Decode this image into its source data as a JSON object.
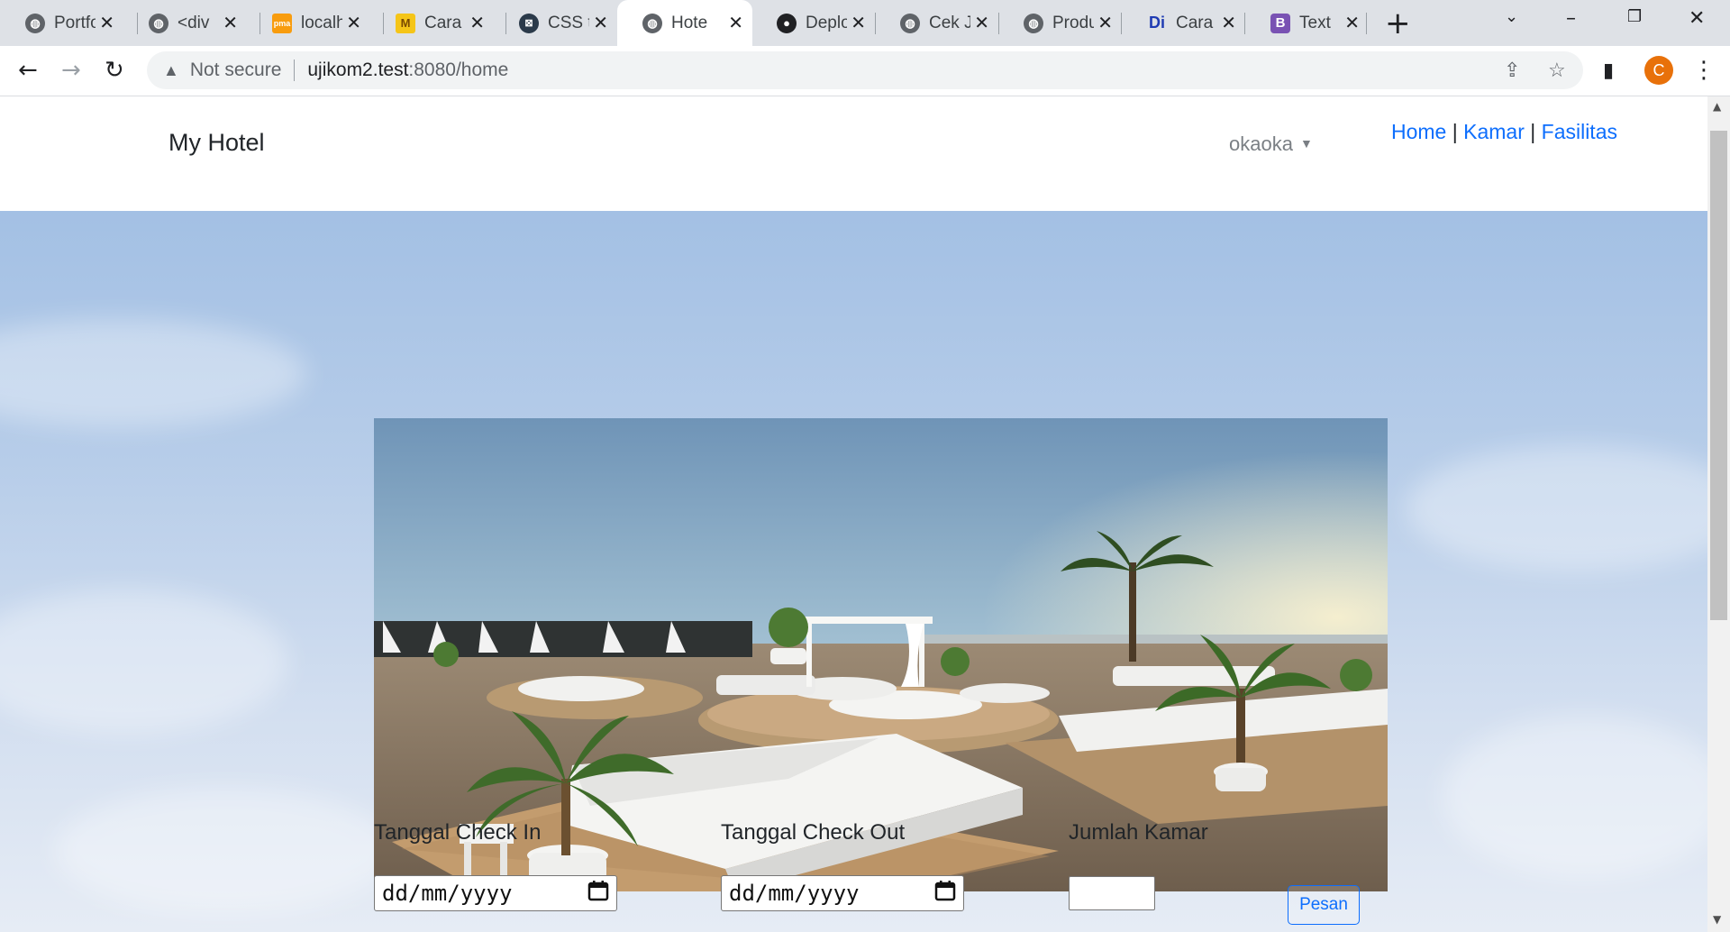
{
  "browser": {
    "tabs": [
      {
        "title": "Portfo",
        "favicon": "globe-icon"
      },
      {
        "title": "<div",
        "favicon": "globe-icon"
      },
      {
        "title": "localh",
        "favicon": "phpmyadmin-icon"
      },
      {
        "title": "Cara",
        "favicon": "mojok-icon"
      },
      {
        "title": "CSS t",
        "favicon": "w3-icon"
      },
      {
        "title": "Hote",
        "favicon": "globe-icon",
        "active": true
      },
      {
        "title": "Deplo",
        "favicon": "github-icon"
      },
      {
        "title": "Cek J",
        "favicon": "globe-icon"
      },
      {
        "title": "Produ",
        "favicon": "globe-icon"
      },
      {
        "title": "Cara",
        "favicon": "dicoding-icon"
      },
      {
        "title": "Text",
        "favicon": "bootstrap-icon"
      }
    ],
    "security_label": "Not secure",
    "url_host": "ujikom2.test",
    "url_rest": ":8080/home",
    "profile_initial": "C"
  },
  "site": {
    "brand": "My Hotel",
    "user": "okaoka",
    "nav": {
      "home": "Home",
      "sep1": " | ",
      "kamar": "Kamar",
      "sep2": " | ",
      "fasilitas": "Fasilitas"
    }
  },
  "booking": {
    "checkin_label": "Tanggal Check In",
    "checkout_label": "Tanggal Check Out",
    "rooms_label": "Jumlah Kamar",
    "checkin_value": "dd/mm/yyyy",
    "checkout_value": "dd/mm/yyyy",
    "submit_label": "Pesan"
  },
  "colors": {
    "link": "#0d6efd",
    "profile": "#e8710a"
  }
}
